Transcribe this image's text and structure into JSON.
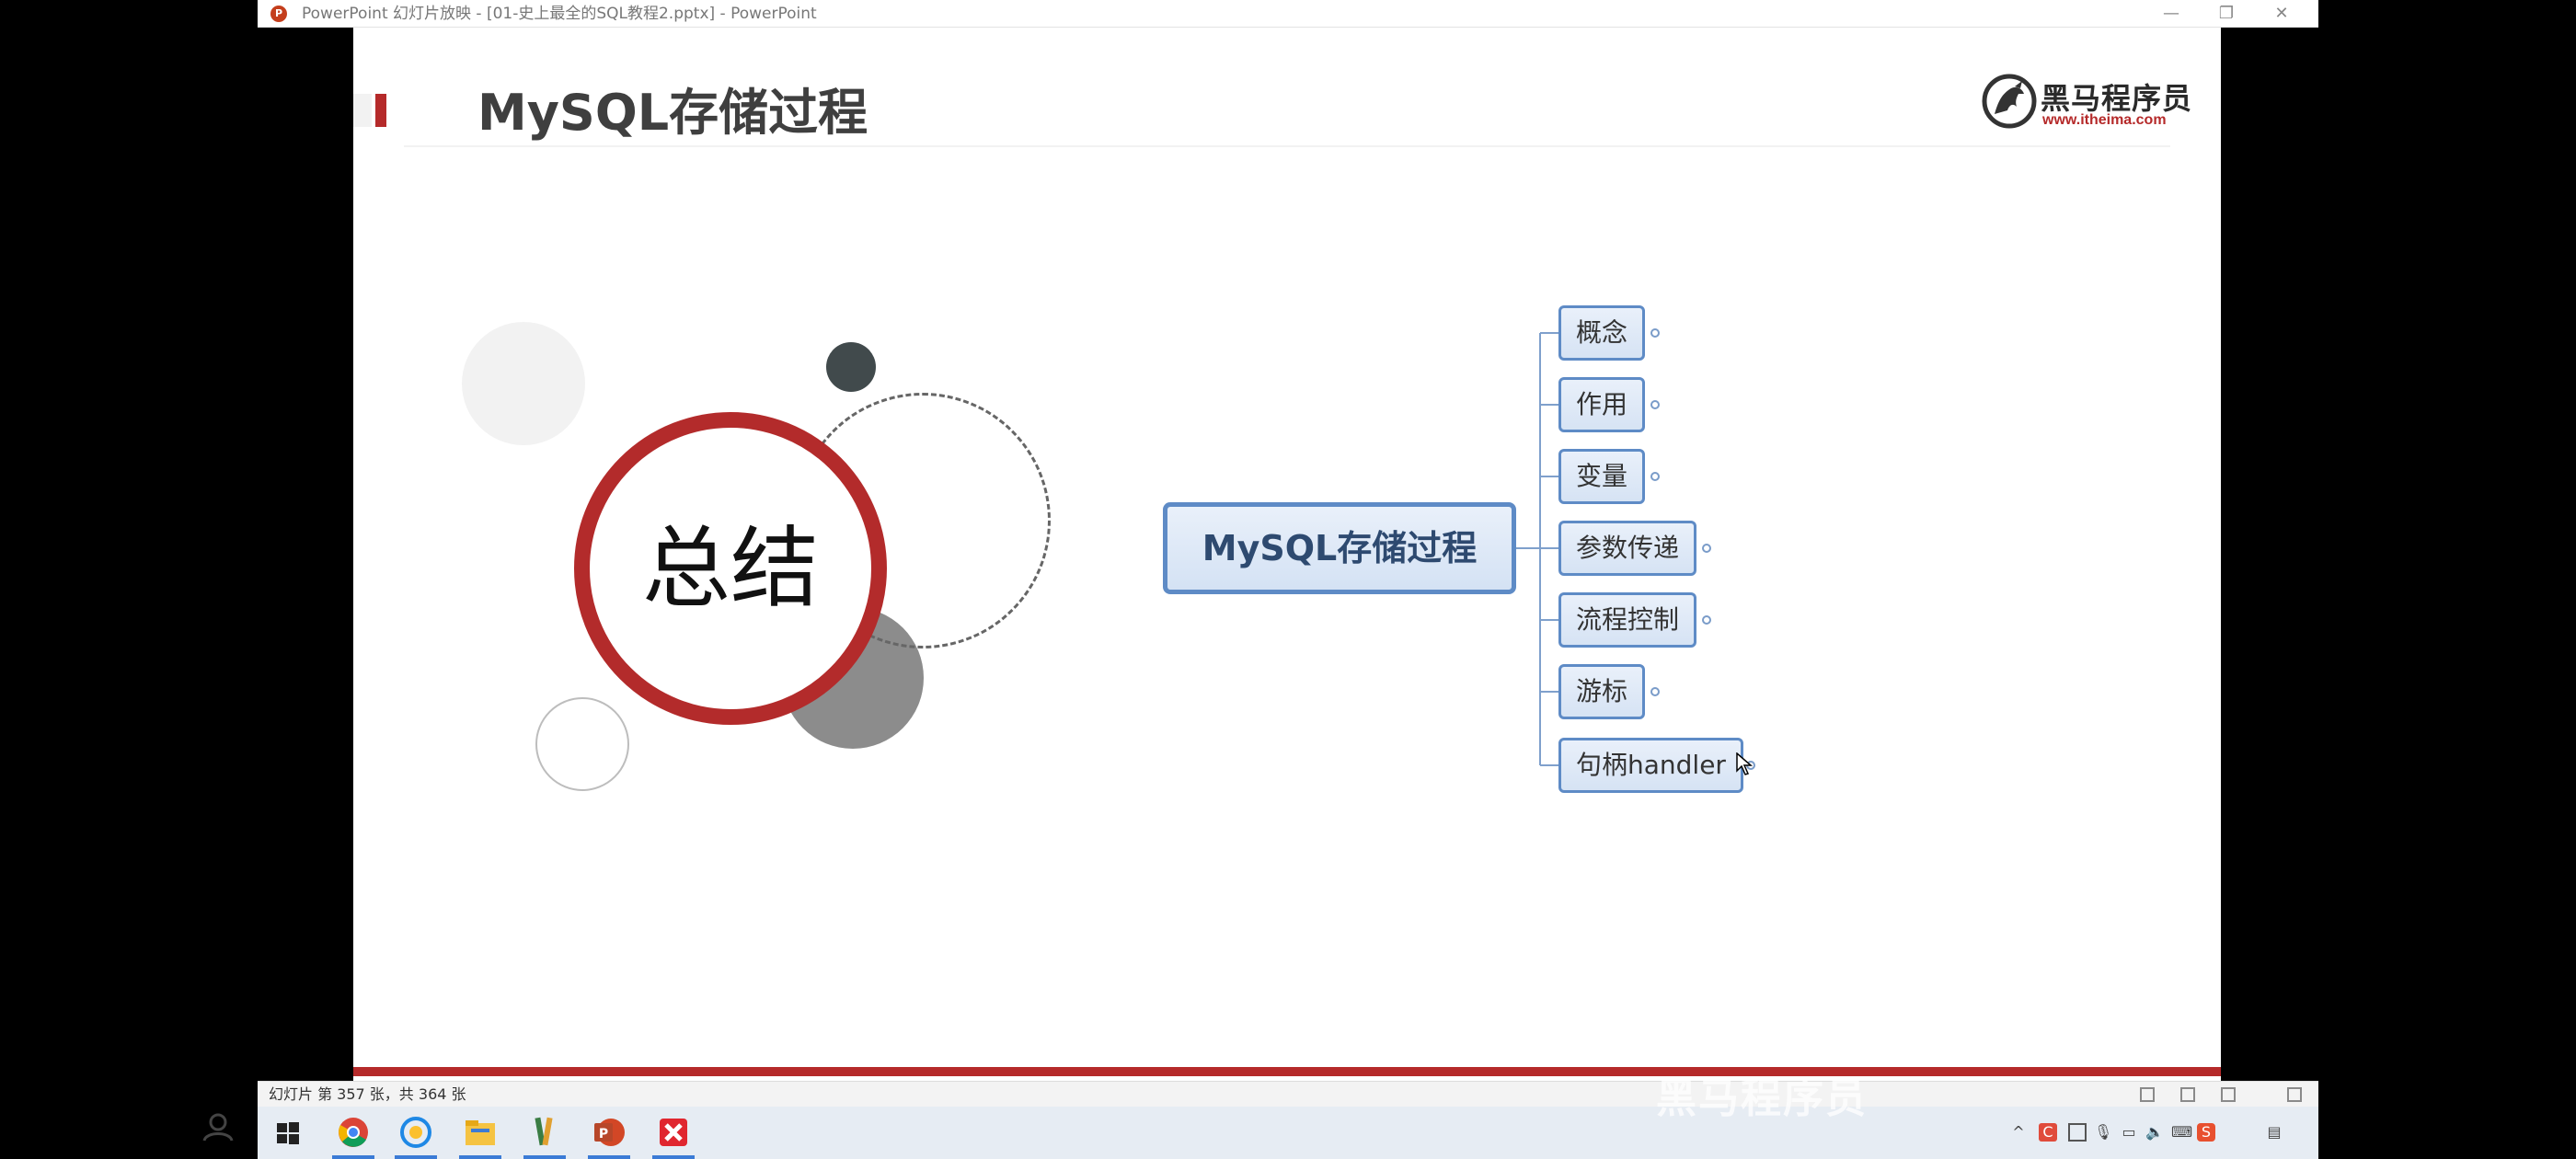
{
  "window": {
    "title": "PowerPoint 幻灯片放映 - [01-史上最全的SQL教程2.pptx] - PowerPoint",
    "minimize_label": "—",
    "restore_label": "❐",
    "close_label": "✕",
    "app_icon": "powerpoint-icon"
  },
  "slide": {
    "title": "MySQL存储过程",
    "logo": {
      "name": "黑马程序员",
      "url": "www.itheima.com"
    },
    "summary_label": "总结",
    "mindmap": {
      "root": "MySQL存储过程",
      "children": [
        "概念",
        "作用",
        "变量",
        "参数传递",
        "流程控制",
        "游标",
        "句柄handler"
      ]
    },
    "accent_color": "#b52a2a",
    "node_border_color": "#5e8bc6"
  },
  "statusbar": {
    "slide_info": "幻灯片 第 357 张，共 364 张",
    "watermark": "黑马程序员"
  },
  "taskbar": {
    "apps": [
      "start-icon",
      "chrome-icon",
      "browser-icon",
      "file-explorer-icon",
      "pencil-app-icon",
      "powerpoint-icon",
      "xmind-icon"
    ],
    "tray": [
      "chevron-up-icon",
      "tray-app-icon",
      "tray-app2-icon",
      "microphone-icon",
      "battery-icon",
      "volume-icon",
      "input-method-icon",
      "sogou-icon",
      "notification-icon"
    ]
  }
}
